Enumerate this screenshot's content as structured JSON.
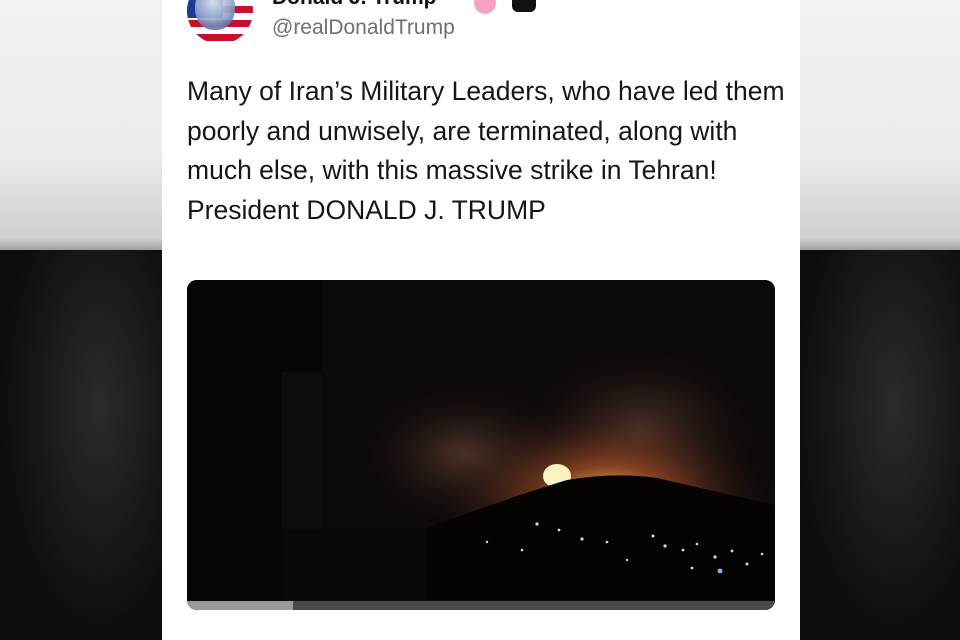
{
  "post": {
    "author": {
      "display_name": "Donald J. Trump",
      "handle": "@realDonaldTrump"
    },
    "text": "Many of Iran’s Military Leaders, who have led them poorly and unwisely, are terminated, along with much else, with this massive strike in Tehran! President DONALD J. TRUMP",
    "media": {
      "type": "video",
      "progress_fraction": 0.18
    }
  },
  "icons": {
    "avatar": "flag-portrait-avatar",
    "verified": "verified-badge-icon",
    "platform": "platform-logo-icon"
  },
  "colors": {
    "background": "#ffffff",
    "text": "#14171a",
    "handle": "#6b6f76",
    "verified_badge": "#f4a3c4"
  }
}
